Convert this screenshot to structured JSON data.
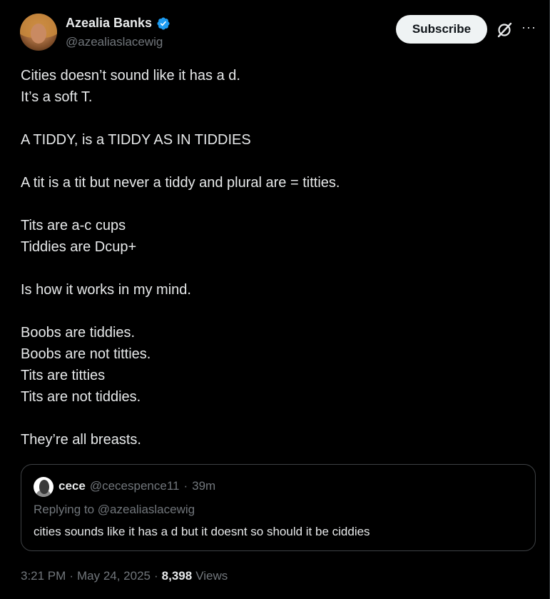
{
  "author": {
    "display_name": "Azealia Banks",
    "handle": "@azealiaslacewig",
    "verified": true
  },
  "actions": {
    "subscribe_label": "Subscribe",
    "grok_icon": "grok-icon",
    "more_icon": "more-icon"
  },
  "tweet": {
    "text": "Cities doesn’t sound like it has a d.\nIt’s a soft T.\n\nA TIDDY, is a TIDDY AS IN TIDDIES\n\nA tit is a tit but never a tiddy and plural are = titties.\n\nTits are a-c cups\nTiddies are Dcup+\n\nIs how it works in my mind.\n\nBoobs are tiddies.\nBoobs are not titties.\nTits are titties\nTits are not tiddies.\n\nThey’re all breasts."
  },
  "quoted": {
    "name": "cece",
    "handle": "@cecespence11",
    "separator": "·",
    "time": "39m",
    "replying_to": "Replying to @azealiaslacewig",
    "text": "cities sounds like it has a d but it doesnt so should it be ciddies"
  },
  "meta": {
    "time": "3:21 PM",
    "sep1": "·",
    "date": "May 24, 2025",
    "sep2": "·",
    "views_count": "8,398",
    "views_label": "Views"
  },
  "colors": {
    "background": "#000000",
    "text": "#e7e9ea",
    "secondary": "#71767b",
    "verified": "#1d9bf0",
    "border": "#3e4144"
  }
}
